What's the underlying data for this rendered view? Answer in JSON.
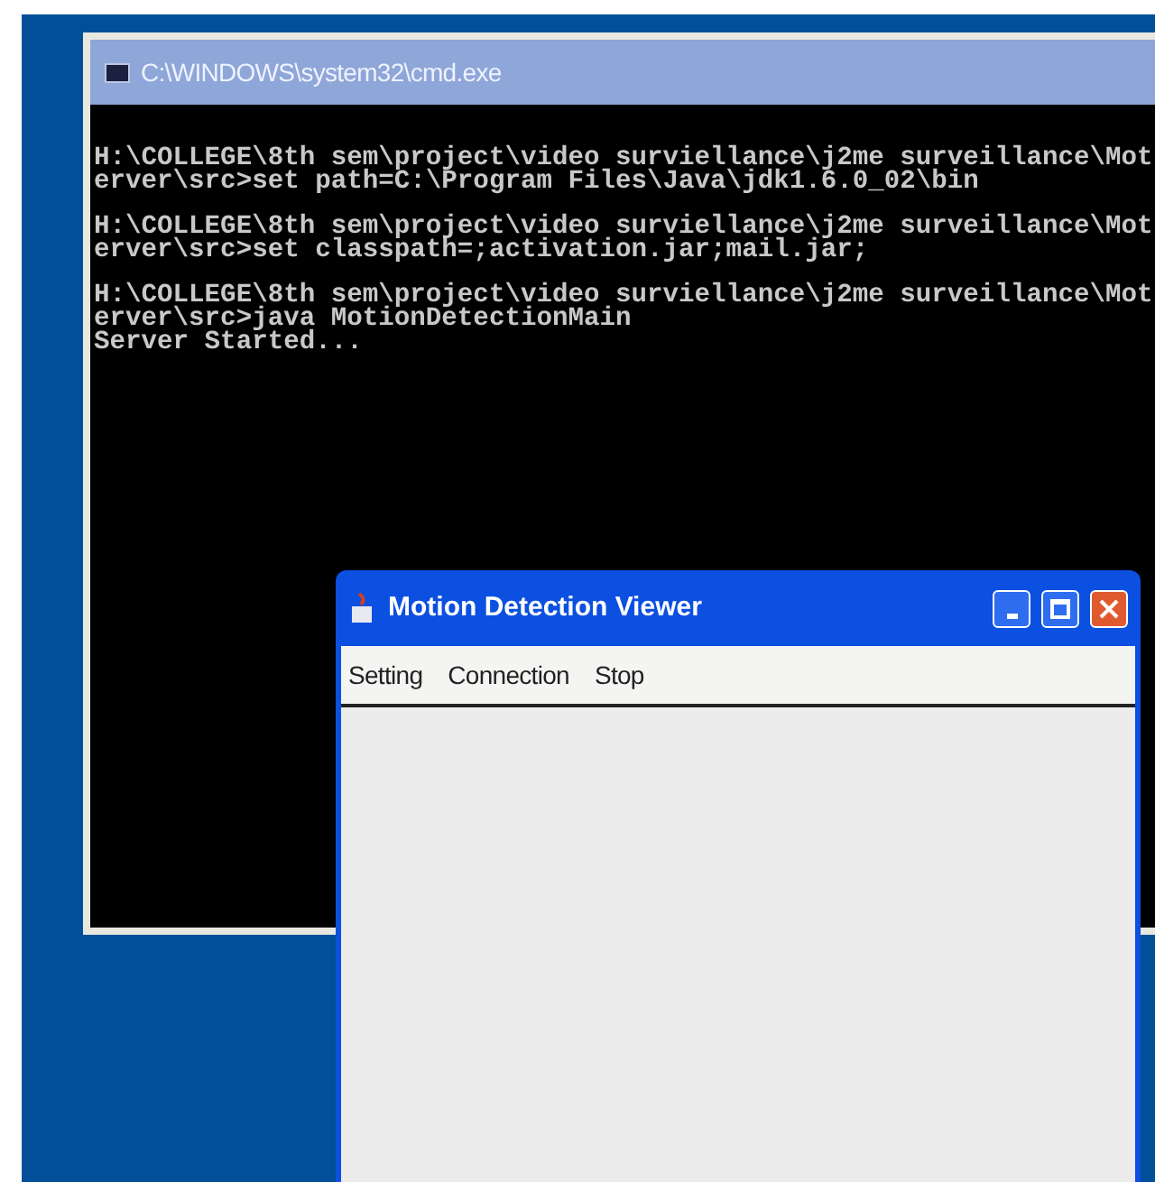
{
  "console_window": {
    "title": "C:\\WINDOWS\\system32\\cmd.exe",
    "blocks": [
      [
        "H:\\COLLEGE\\8th sem\\project\\video surviellance\\j2me surveillance\\Mot",
        "erver\\src>set path=C:\\Program Files\\Java\\jdk1.6.0_02\\bin"
      ],
      [
        "H:\\COLLEGE\\8th sem\\project\\video surviellance\\j2me surveillance\\Mot",
        "erver\\src>set classpath=;activation.jar;mail.jar;"
      ],
      [
        "H:\\COLLEGE\\8th sem\\project\\video surviellance\\j2me surveillance\\Mot",
        "erver\\src>java MotionDetectionMain",
        "Server Started..."
      ]
    ]
  },
  "viewer_window": {
    "title": "Motion Detection Viewer",
    "menu": [
      "Setting",
      "Connection",
      "Stop"
    ]
  }
}
